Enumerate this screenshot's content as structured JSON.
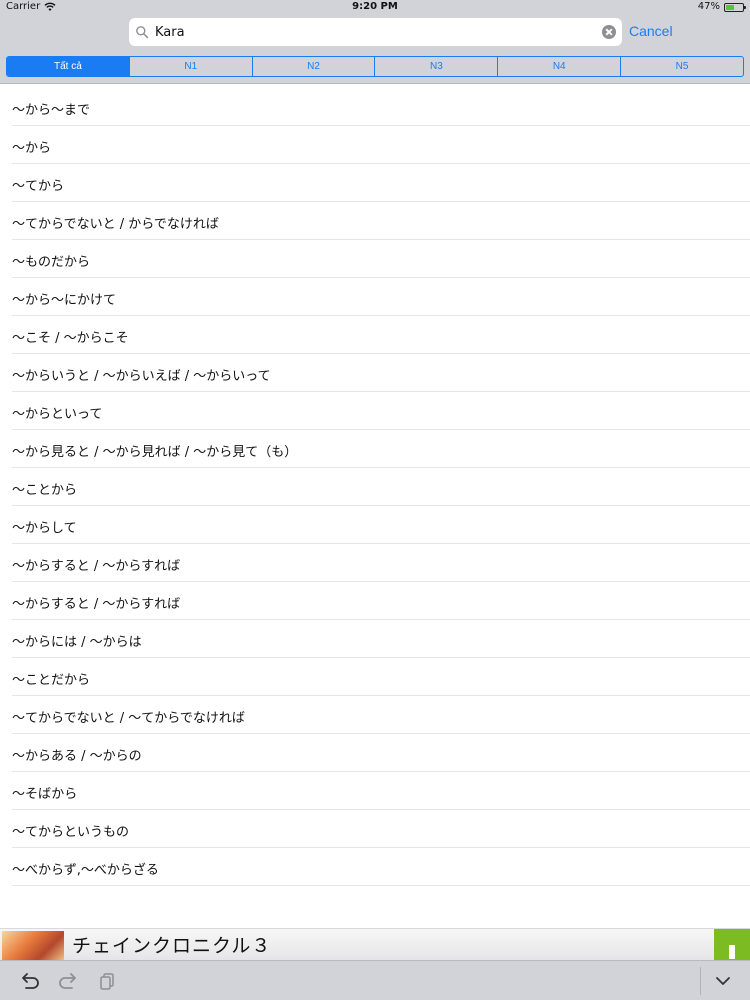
{
  "status_bar": {
    "carrier": "Carrier",
    "time": "9:20 PM",
    "battery": "47%",
    "battery_level": 0.47
  },
  "search": {
    "value": "Kara",
    "cancel_label": "Cancel"
  },
  "segments": [
    {
      "label": "Tất cả",
      "active": true
    },
    {
      "label": "N1",
      "active": false
    },
    {
      "label": "N2",
      "active": false
    },
    {
      "label": "N3",
      "active": false
    },
    {
      "label": "N4",
      "active": false
    },
    {
      "label": "N5",
      "active": false
    }
  ],
  "results": [
    "～から～まで",
    "～から",
    "～てから",
    "～てからでないと / からでなければ",
    "～ものだから",
    "～から～にかけて",
    "～こそ / ～からこそ",
    "～からいうと / ～からいえば / ～からいって",
    "～からといって",
    "～から見ると / ～から見れば / ～から見て（も）",
    "～ことから",
    "～からして",
    "～からすると / ～からすれば",
    "～からすると / ～からすれば",
    "～からには / ～からは",
    "～ことだから",
    "～てからでないと / ～てからでなければ",
    "～からある / ～からの",
    "～そばから",
    "～てからというもの",
    "～べからず,～べからざる"
  ],
  "ad": {
    "title": "チェインクロニクル３",
    "accent_color": "#7cbc22"
  },
  "colors": {
    "accent": "#1a7cf3",
    "header_bg": "#d1d3d8"
  }
}
